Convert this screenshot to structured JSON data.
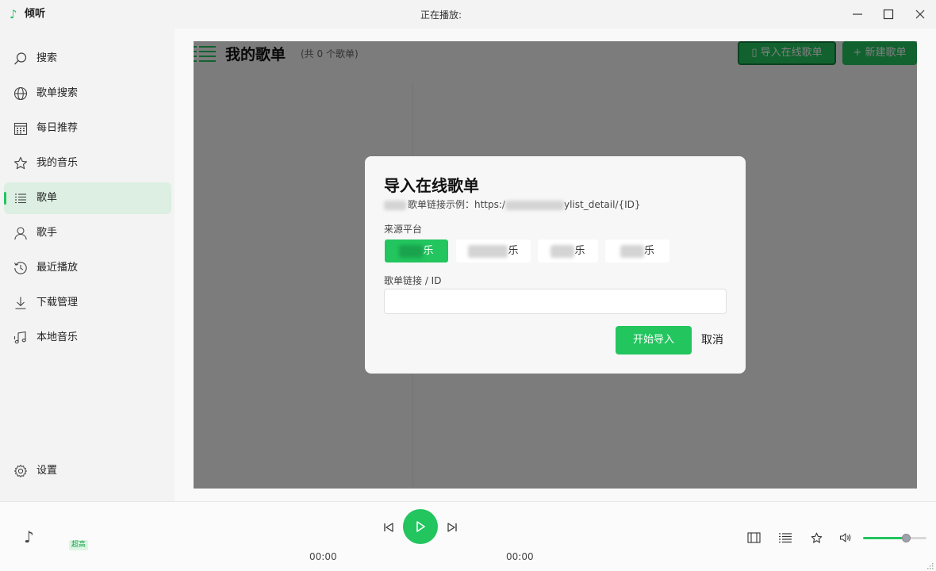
{
  "app": {
    "name": "倾听",
    "logo_icon": "music-note-icon",
    "now_playing": "正在播放:",
    "accent_color": "#22c55e"
  },
  "sidebar": {
    "items": [
      {
        "label": "搜索",
        "icon": "search-icon"
      },
      {
        "label": "歌单搜索",
        "icon": "globe-icon"
      },
      {
        "label": "每日推荐",
        "icon": "calendar-icon"
      },
      {
        "label": "我的音乐",
        "icon": "star-icon"
      },
      {
        "label": "歌单",
        "icon": "list-icon",
        "active": true
      },
      {
        "label": "歌手",
        "icon": "person-icon"
      },
      {
        "label": "最近播放",
        "icon": "history-icon"
      },
      {
        "label": "下载管理",
        "icon": "download-icon"
      },
      {
        "label": "本地音乐",
        "icon": "local-music-icon"
      }
    ],
    "settings": {
      "label": "设置",
      "icon": "gear-icon"
    }
  },
  "main": {
    "title": "我的歌单",
    "count": "(共 0 个歌单)",
    "import_online_label": "▯ 导入在线歌单",
    "new_playlist_label": "+ 新建歌单"
  },
  "dialog": {
    "title": "导入在线歌单",
    "hint_prefix": "歌单链接示例：https:/",
    "hint_suffix": "ylist_detail/{ID}",
    "platform_label": "来源平台",
    "platforms": [
      {
        "label": "乐",
        "active": true
      },
      {
        "label": "乐",
        "active": false
      },
      {
        "label": "乐",
        "active": false
      },
      {
        "label": "乐",
        "active": false
      }
    ],
    "link_label": "歌单链接 / ID",
    "link_value": "",
    "link_placeholder": "",
    "start_button": "开始导入",
    "cancel_button": "取消"
  },
  "player": {
    "quality_badge": "超高",
    "current_time": "00:00",
    "total_time": "00:00",
    "volume_percent": 68
  }
}
